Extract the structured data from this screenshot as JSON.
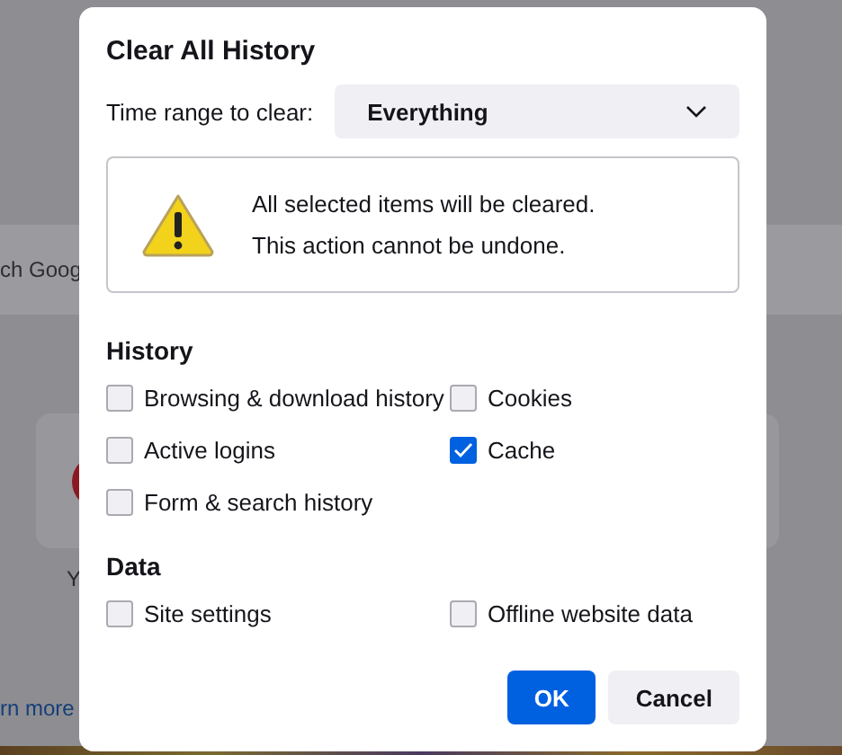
{
  "background": {
    "search_text": "ch Goog",
    "tile_label": "Y",
    "link": "rn more"
  },
  "dialog": {
    "title": "Clear All History",
    "time_range": {
      "label": "Time range to clear:",
      "value": "Everything"
    },
    "warning": [
      "All selected items will be cleared.",
      "This action cannot be undone."
    ],
    "sections": [
      {
        "heading": "History",
        "items": [
          {
            "label": "Browsing & download history",
            "checked": false
          },
          {
            "label": "Cookies",
            "checked": false
          },
          {
            "label": "Active logins",
            "checked": false
          },
          {
            "label": "Cache",
            "checked": true
          },
          {
            "label": "Form & search history",
            "checked": false
          }
        ]
      },
      {
        "heading": "Data",
        "items": [
          {
            "label": "Site settings",
            "checked": false
          },
          {
            "label": "Offline website data",
            "checked": false
          }
        ]
      }
    ],
    "buttons": [
      {
        "label": "OK",
        "kind": "primary"
      },
      {
        "label": "Cancel",
        "kind": "secondary"
      }
    ]
  }
}
